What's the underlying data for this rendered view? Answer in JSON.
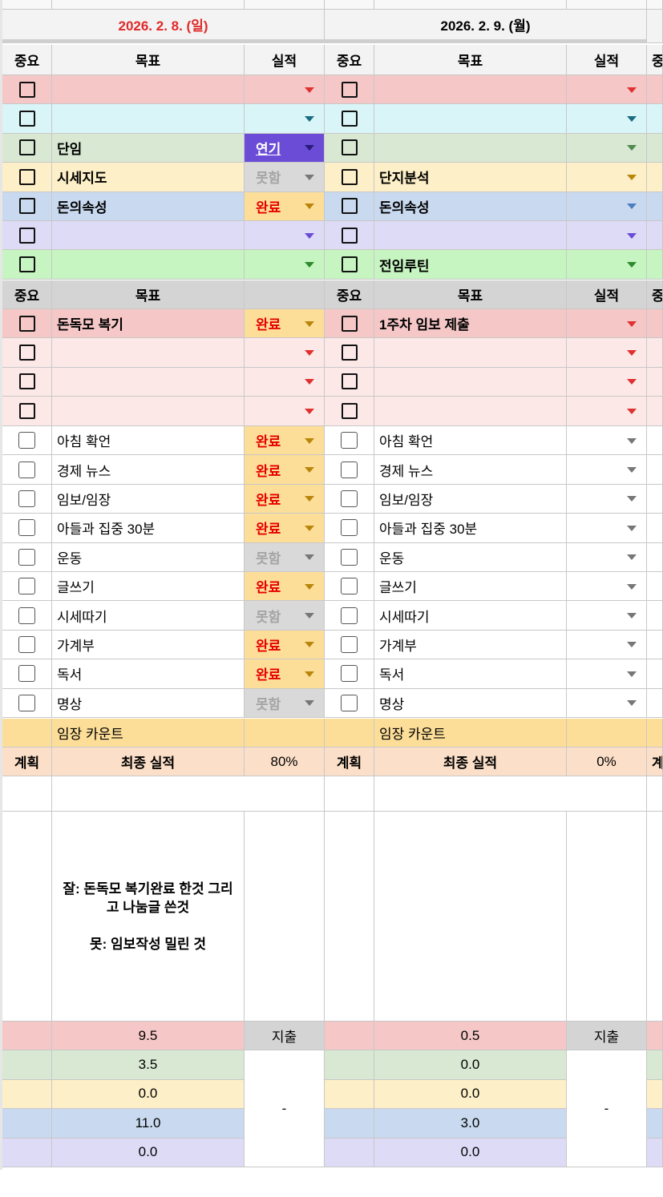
{
  "colors": {
    "red": "#f5c7c7",
    "cyan": "#d9f5f8",
    "green": "#d8e8d3",
    "yellow": "#fdefc7",
    "blue": "#c9daf0",
    "purple": "#dedbf7",
    "lime": "#c6f5c1",
    "gray": "#d4d4d4",
    "pinkLight": "#fde8e8",
    "orange": "#fcdfc8",
    "gold": "#fdde99",
    "date_red": "#e02a2a"
  },
  "headers": {
    "importance": "중요",
    "goal": "목표",
    "result": "실적",
    "plan": "계획",
    "final_result": "최종 실적",
    "expense": "지출"
  },
  "days": [
    {
      "date": "2026. 2. 8. (일)",
      "date_color": "#e02a2a",
      "top_goals": [
        {
          "goal": "",
          "result": "",
          "arrow": "#e03030"
        },
        {
          "goal": "",
          "result": "",
          "arrow": "#1a6d80"
        },
        {
          "goal": "단임",
          "result": "연기",
          "arrow": "#5b2ccf"
        },
        {
          "goal": "시세지도",
          "result": "못함",
          "arrow": "#777777"
        },
        {
          "goal": "돈의속성",
          "result": "완료",
          "arrow": "#b8860b"
        },
        {
          "goal": "",
          "result": "",
          "arrow": "#6a4cd6"
        },
        {
          "goal": "",
          "result": "",
          "arrow": "#2e8b2e"
        }
      ],
      "mid_header_result": "",
      "priority_tasks": [
        {
          "goal": "돈독모 복기",
          "result": "완료"
        },
        {
          "goal": "",
          "result": ""
        },
        {
          "goal": "",
          "result": ""
        },
        {
          "goal": "",
          "result": ""
        }
      ],
      "habits": [
        {
          "goal": "아침 확언",
          "result": "완료"
        },
        {
          "goal": "경제 뉴스",
          "result": "완료"
        },
        {
          "goal": "임보/임장",
          "result": "완료"
        },
        {
          "goal": "아들과 집중 30분",
          "result": "완료"
        },
        {
          "goal": "운동",
          "result": "못함"
        },
        {
          "goal": "글쓰기",
          "result": "완료"
        },
        {
          "goal": "시세따기",
          "result": "못함"
        },
        {
          "goal": "가계부",
          "result": "완료"
        },
        {
          "goal": "독서",
          "result": "완료"
        },
        {
          "goal": "명상",
          "result": "못함"
        }
      ],
      "count_label": "임장 카운트",
      "final_percent": "80%",
      "memo_line1": "잘: 돈독모 복기완료 한것 그리고 나눔글 쓴것",
      "memo_line2": "못: 임보작성 밀린 것",
      "hours": [
        "9.5",
        "3.5",
        "0.0",
        "11.0",
        "0.0"
      ],
      "expense_value": "-"
    },
    {
      "date": "2026. 2. 9. (월)",
      "date_color": "#000000",
      "top_goals": [
        {
          "goal": "",
          "result": "",
          "arrow": "#e03030"
        },
        {
          "goal": "",
          "result": "",
          "arrow": "#1a6d80"
        },
        {
          "goal": "",
          "result": "",
          "arrow": "#4f8a4f"
        },
        {
          "goal": "단지분석",
          "result": "",
          "arrow": "#b8860b"
        },
        {
          "goal": "돈의속성",
          "result": "",
          "arrow": "#4a7fc1"
        },
        {
          "goal": "",
          "result": "",
          "arrow": "#6a4cd6"
        },
        {
          "goal": "전임루틴",
          "result": "",
          "arrow": "#2e8b2e"
        }
      ],
      "mid_header_result": "실적",
      "priority_tasks": [
        {
          "goal": "1주차 임보 제출",
          "result": ""
        },
        {
          "goal": "",
          "result": ""
        },
        {
          "goal": "",
          "result": ""
        },
        {
          "goal": "",
          "result": ""
        }
      ],
      "habits": [
        {
          "goal": "아침 확언",
          "result": ""
        },
        {
          "goal": "경제 뉴스",
          "result": ""
        },
        {
          "goal": "임보/임장",
          "result": ""
        },
        {
          "goal": "아들과 집중 30분",
          "result": ""
        },
        {
          "goal": "운동",
          "result": ""
        },
        {
          "goal": "글쓰기",
          "result": ""
        },
        {
          "goal": "시세따기",
          "result": ""
        },
        {
          "goal": "가계부",
          "result": ""
        },
        {
          "goal": "독서",
          "result": ""
        },
        {
          "goal": "명상",
          "result": ""
        }
      ],
      "count_label": "임장 카운트",
      "final_percent": "0%",
      "memo_line1": "",
      "memo_line2": "",
      "hours": [
        "0.5",
        "0.0",
        "0.0",
        "3.0",
        "0.0"
      ],
      "expense_value": "-"
    }
  ],
  "next_day_partial_headers": {
    "importance": "중",
    "plan": "계"
  }
}
